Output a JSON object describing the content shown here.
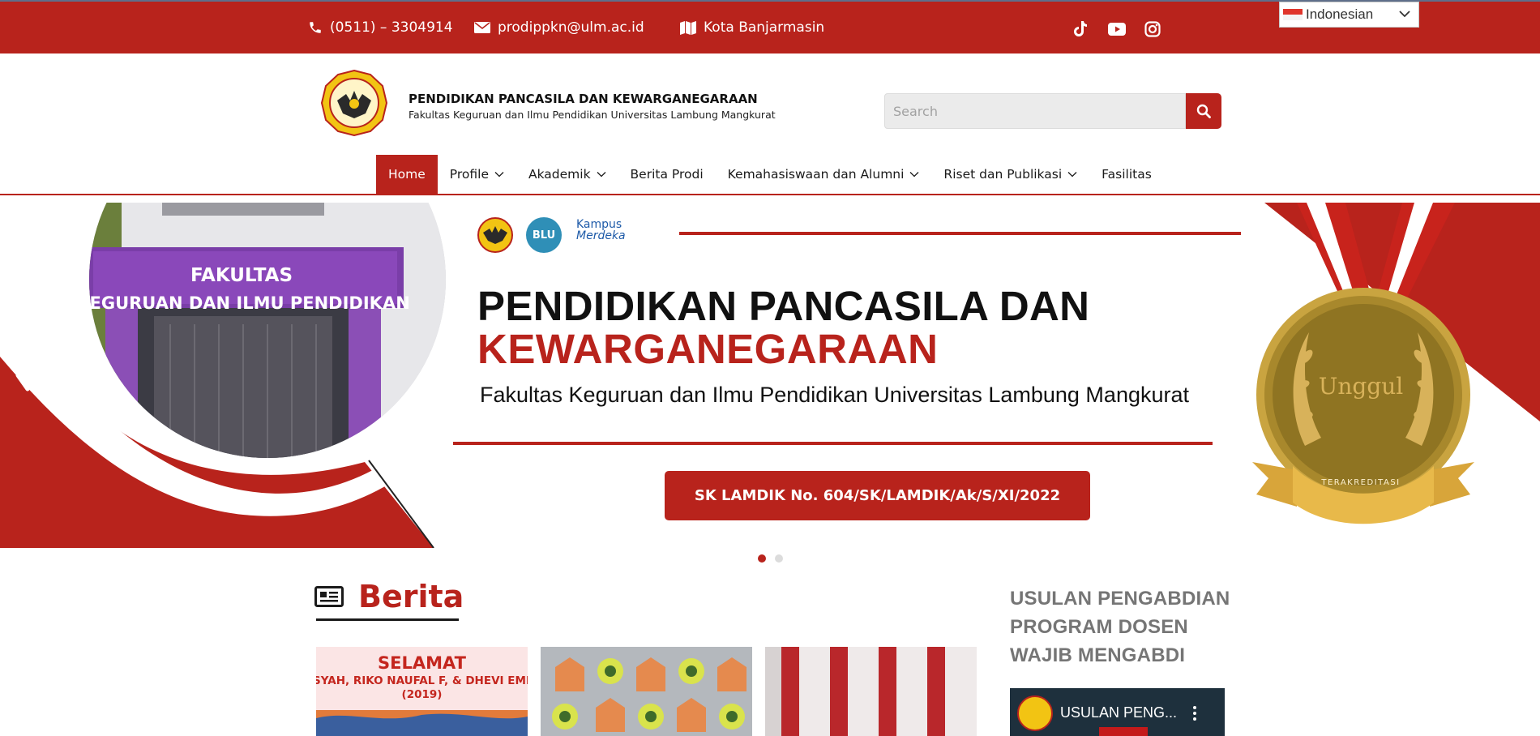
{
  "topbar": {
    "phone": "(0511) – 3304914",
    "email": "prodippkn@ulm.ac.id",
    "location": "Kota Banjarmasin",
    "social_icons": [
      "tiktok-icon",
      "youtube-icon",
      "instagram-icon"
    ],
    "language": "Indonesian"
  },
  "header": {
    "title": "PENDIDIKAN PANCASILA DAN KEWARGANEGARAAN",
    "subtitle": "Fakultas Keguruan dan Ilmu Pendidikan Universitas Lambung Mangkurat",
    "search_placeholder": "Search"
  },
  "nav": {
    "items": [
      {
        "label": "Home",
        "active": true
      },
      {
        "label": "Profile",
        "dropdown": true
      },
      {
        "label": "Akademik",
        "dropdown": true
      },
      {
        "label": "Berita Prodi"
      },
      {
        "label": "Kemahasiswaan dan Alumni",
        "dropdown": true
      },
      {
        "label": "Riset dan Publikasi",
        "dropdown": true
      },
      {
        "label": "Fasilitas"
      }
    ]
  },
  "hero": {
    "building_sign_1": "FAKULTAS",
    "building_sign_2": "KEGURUAN DAN ILMU PENDIDIKAN",
    "title_line1": "PENDIDIKAN PANCASILA DAN",
    "title_line2": "KEWARGANEGARAAN",
    "subtitle": "Fakultas Keguruan dan Ilmu Pendidikan Universitas Lambung Mangkurat",
    "button": "SK LAMDIK No. 604/SK/LAMDIK/Ak/S/XI/2022",
    "medal_text": "Unggul",
    "medal_ribbon": "TERAKREDITASI",
    "partner_blu": "BLU",
    "partner_kampus": "Kampus",
    "partner_merdeka": "Merdeka",
    "slide_count": 2,
    "active_slide": 1
  },
  "news": {
    "title": "Berita",
    "card1_line1": "SELAMAT",
    "card1_line2": "SYAH, RIKO NAUFAL F, & DHEVI EMI",
    "card1_line3": "(2019)"
  },
  "sidebar": {
    "title": "USULAN PENGABDIAN PROGRAM DOSEN WAJIB MENGABDI",
    "video_title": "USULAN PENG..."
  },
  "colors": {
    "brand_red": "#b8231c",
    "gold": "#a8882c"
  }
}
